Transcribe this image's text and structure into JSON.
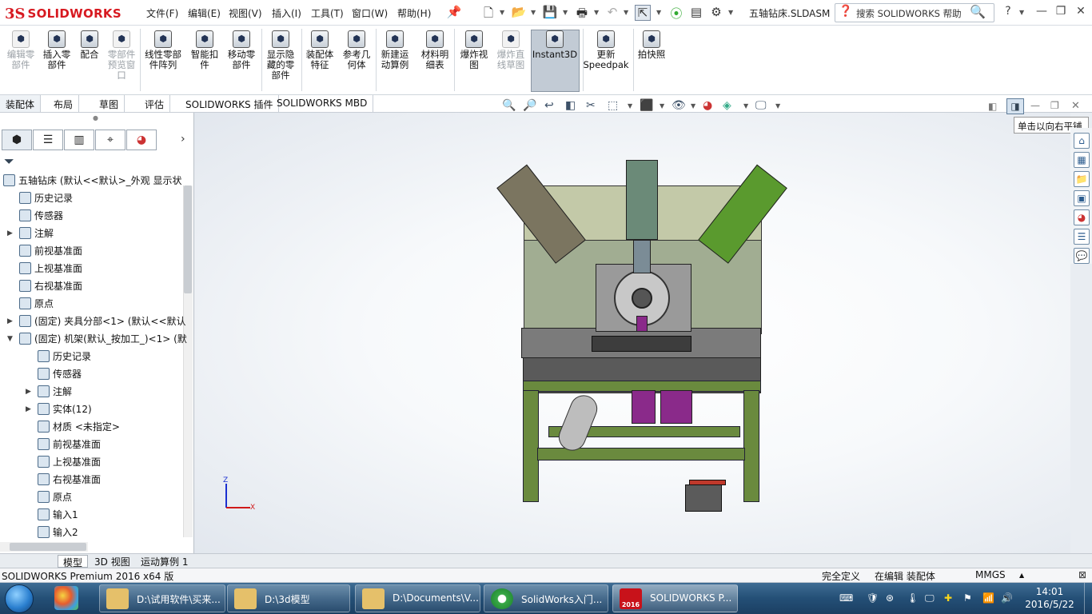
{
  "app": {
    "logo_ds": "3S",
    "logo_text": "SOLIDWORKS",
    "document_title": "五轴钻床.SLDASM"
  },
  "menu": [
    "文件(F)",
    "编辑(E)",
    "视图(V)",
    "插入(I)",
    "工具(T)",
    "窗口(W)",
    "帮助(H)"
  ],
  "search": {
    "placeholder": "搜索 SOLIDWORKS 帮助"
  },
  "commands": [
    {
      "label": "编辑零\n部件",
      "icon": "edit-component-icon",
      "enabled": false
    },
    {
      "label": "插入零\n部件",
      "icon": "insert-component-icon",
      "enabled": true
    },
    {
      "label": "配合",
      "icon": "mate-icon",
      "enabled": true
    },
    {
      "label": "零部件\n预览窗\n口",
      "icon": "component-preview-icon",
      "enabled": false
    },
    {
      "label": "线性零部\n件阵列",
      "icon": "linear-pattern-icon",
      "enabled": true
    },
    {
      "label": "智能扣\n件",
      "icon": "smart-fastener-icon",
      "enabled": true
    },
    {
      "label": "移动零\n部件",
      "icon": "move-component-icon",
      "enabled": true
    },
    {
      "label": "显示隐\n藏的零\n部件",
      "icon": "show-hidden-icon",
      "enabled": true
    },
    {
      "label": "装配体\n特征",
      "icon": "assembly-feature-icon",
      "enabled": true
    },
    {
      "label": "参考几\n何体",
      "icon": "reference-geometry-icon",
      "enabled": true
    },
    {
      "label": "新建运\n动算例",
      "icon": "motion-study-icon",
      "enabled": true
    },
    {
      "label": "材料明\n细表",
      "icon": "bom-icon",
      "enabled": true
    },
    {
      "label": "爆炸视\n图",
      "icon": "exploded-view-icon",
      "enabled": true
    },
    {
      "label": "爆炸直\n线草图",
      "icon": "explode-line-icon",
      "enabled": false
    },
    {
      "label": "Instant3D",
      "icon": "instant3d-icon",
      "enabled": true
    },
    {
      "label": "更新\nSpeedpak",
      "icon": "speedpak-icon",
      "enabled": true
    },
    {
      "label": "拍快照",
      "icon": "snapshot-icon",
      "enabled": true
    }
  ],
  "command_tabs": [
    "装配体",
    "布局",
    "草图",
    "评估",
    "SOLIDWORKS 插件",
    "SOLIDWORKS MBD"
  ],
  "tooltip": "单击以向右平铺",
  "tree": {
    "root": "五轴钻床 (默认<<默认>_外观 显示状",
    "items": [
      "历史记录",
      "传感器",
      "注解",
      "前视基准面",
      "上视基准面",
      "右视基准面",
      "原点",
      "(固定) 夹具分部<1> (默认<<默认",
      "(固定) 机架(默认_按加工_)<1> (默",
      "历史记录",
      "传感器",
      "注解",
      "实体(12)",
      "材质 <未指定>",
      "前视基准面",
      "上视基准面",
      "右视基准面",
      "原点",
      "输入1",
      "输入2"
    ]
  },
  "triad": {
    "z": "Z",
    "x": "X"
  },
  "model_tabs": [
    "模型",
    "3D 视图",
    "运动算例 1"
  ],
  "status": {
    "product": "SOLIDWORKS Premium 2016 x64 版",
    "definition": "完全定义",
    "mode": "在编辑 装配体",
    "units": "MMGS"
  },
  "taskbar": {
    "buttons": [
      "D:\\试用软件\\买来...",
      "D:\\3d模型",
      "D:\\Documents\\V...",
      "SolidWorks入门...",
      "SOLIDWORKS P..."
    ],
    "sw_year": "2016",
    "time": "14:01",
    "date": "2016/5/22"
  }
}
